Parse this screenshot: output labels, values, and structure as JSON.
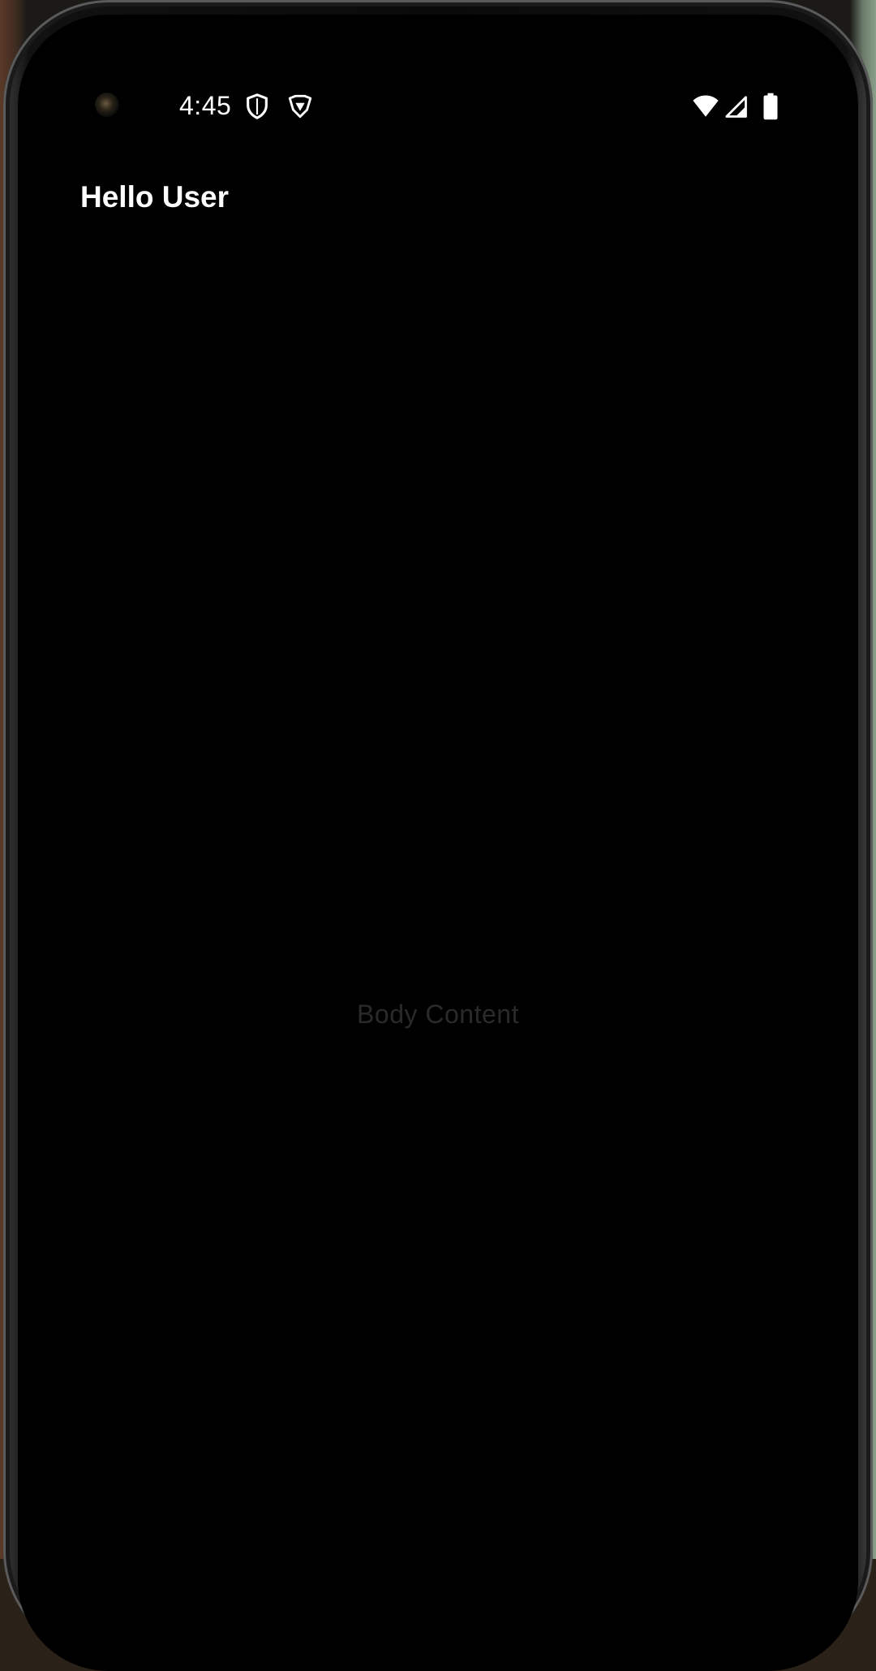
{
  "status_bar": {
    "time": "4:45",
    "icons": [
      "vpn-shield-icon",
      "brave-shield-icon",
      "wifi-icon",
      "cellular-signal-icon",
      "battery-icon"
    ]
  },
  "app_bar": {
    "title": "Hello User"
  },
  "body": {
    "placeholder": "Body Content"
  },
  "colors": {
    "background": "#000000",
    "title_text": "#ffffff",
    "body_text": "#2a2a2a"
  }
}
